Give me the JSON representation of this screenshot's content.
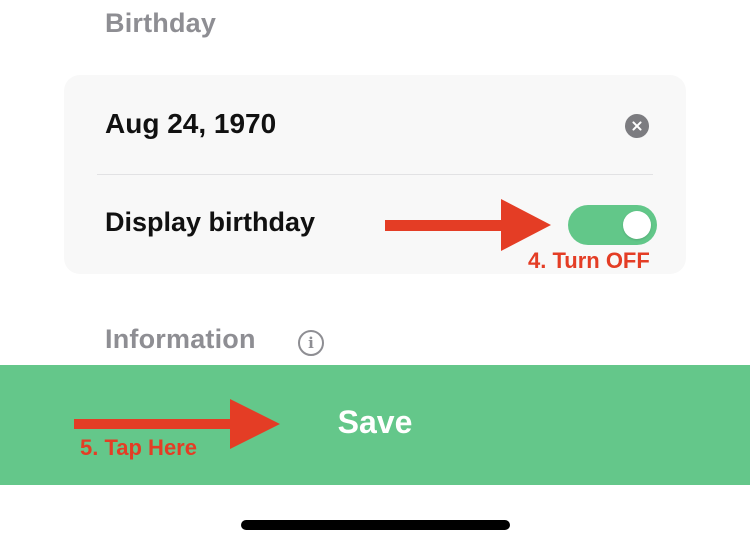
{
  "sections": {
    "birthday_title": "Birthday",
    "information_title": "Information"
  },
  "info_icon": {
    "glyph": "i",
    "icon": "info-circle-icon"
  },
  "birthday_card": {
    "date_value": "Aug 24, 1970",
    "clear_icon": "clear-x-circle-icon",
    "display_label": "Display birthday",
    "display_toggle_on": true
  },
  "annotations": {
    "step4": "4.  Turn OFF",
    "step5": "5.  Tap Here",
    "arrow_color": "#e43d25"
  },
  "save_button": {
    "label": "Save",
    "color": "#64c78a"
  },
  "colors": {
    "toggle_on": "#62c789",
    "section_title": "#8e8e93",
    "card_background": "#f8f8f8"
  }
}
